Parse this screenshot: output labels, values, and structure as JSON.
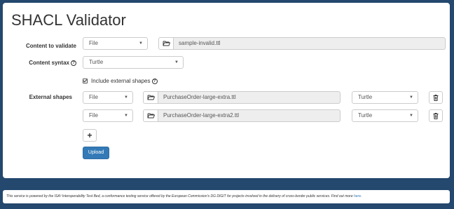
{
  "page": {
    "title": "SHACL Validator"
  },
  "form": {
    "content_to_validate": {
      "label": "Content to validate",
      "source_type": "File",
      "file_name": "sample-invalid.ttl"
    },
    "content_syntax": {
      "label": "Content syntax",
      "value": "Turtle"
    },
    "include_external": {
      "label": "Include external shapes",
      "checked": true
    },
    "external_shapes": {
      "label": "External shapes",
      "rows": [
        {
          "source_type": "File",
          "file_name": "PurchaseOrder-large-extra.ttl",
          "syntax": "Turtle"
        },
        {
          "source_type": "File",
          "file_name": "PurchaseOrder-large-extra2.ttl",
          "syntax": "Turtle"
        }
      ]
    },
    "add_button_label": "+",
    "upload_button_label": "Upload"
  },
  "footer": {
    "text": "This service is powered by the ISA² Interoperability Test Bed, a conformance testing service offered by the European Commission's DG DIGIT for projects involved in the delivery of cross-border public services. Find out more ",
    "link_text": "here",
    "end": "."
  },
  "icons": {
    "help": "help-circle-icon",
    "folder": "folder-open-icon",
    "trash": "trash-icon",
    "caret": "caret-down-icon"
  },
  "colors": {
    "background": "#24486e",
    "primary": "#337ab7"
  }
}
